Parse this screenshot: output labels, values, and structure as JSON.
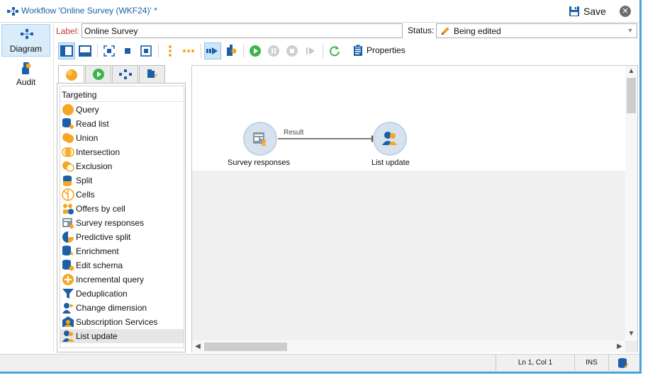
{
  "window": {
    "title": "Workflow 'Online Survey (WKF24)' *",
    "save_label": "Save",
    "close_glyph": "✕"
  },
  "nav": {
    "items": [
      {
        "label": "Diagram",
        "icon": "diagram-icon",
        "active": true
      },
      {
        "label": "Audit",
        "icon": "audit-icon",
        "active": false
      }
    ]
  },
  "form": {
    "label_caption": "Label:",
    "label_value": "Online Survey",
    "status_caption": "Status:",
    "status_value": "Being edited"
  },
  "toolbar": {
    "properties_label": "Properties"
  },
  "palette": {
    "tabs": [
      "targeting-tab-icon",
      "flow-control-tab-icon",
      "actions-tab-icon",
      "events-tab-icon"
    ],
    "header": "Targeting",
    "items": [
      {
        "label": "Query",
        "icon": "query-icon"
      },
      {
        "label": "Read list",
        "icon": "read-list-icon"
      },
      {
        "label": "Union",
        "icon": "union-icon"
      },
      {
        "label": "Intersection",
        "icon": "intersection-icon"
      },
      {
        "label": "Exclusion",
        "icon": "exclusion-icon"
      },
      {
        "label": "Split",
        "icon": "split-icon"
      },
      {
        "label": "Cells",
        "icon": "cells-icon"
      },
      {
        "label": "Offers by cell",
        "icon": "offers-by-cell-icon"
      },
      {
        "label": "Survey responses",
        "icon": "survey-responses-icon"
      },
      {
        "label": "Predictive split",
        "icon": "predictive-split-icon"
      },
      {
        "label": "Enrichment",
        "icon": "enrichment-icon"
      },
      {
        "label": "Edit schema",
        "icon": "edit-schema-icon"
      },
      {
        "label": "Incremental query",
        "icon": "incremental-query-icon"
      },
      {
        "label": "Deduplication",
        "icon": "deduplication-icon"
      },
      {
        "label": "Change dimension",
        "icon": "change-dimension-icon"
      },
      {
        "label": "Subscription Services",
        "icon": "subscription-services-icon"
      },
      {
        "label": "List update",
        "icon": "list-update-icon",
        "selected": true
      }
    ]
  },
  "canvas": {
    "nodes": [
      {
        "label": "Survey responses",
        "icon": "survey-responses-icon"
      },
      {
        "label": "List update",
        "icon": "list-update-icon"
      }
    ],
    "transition_label": "Result"
  },
  "statusbar": {
    "position": "Ln 1, Col 1",
    "mode": "INS"
  },
  "colors": {
    "accent": "#1b5fa8",
    "orange": "#f5a623",
    "node_bg": "#d6e3ef",
    "label_red": "#c0392b",
    "green": "#3cb54a",
    "window_border": "#4aa3df"
  }
}
